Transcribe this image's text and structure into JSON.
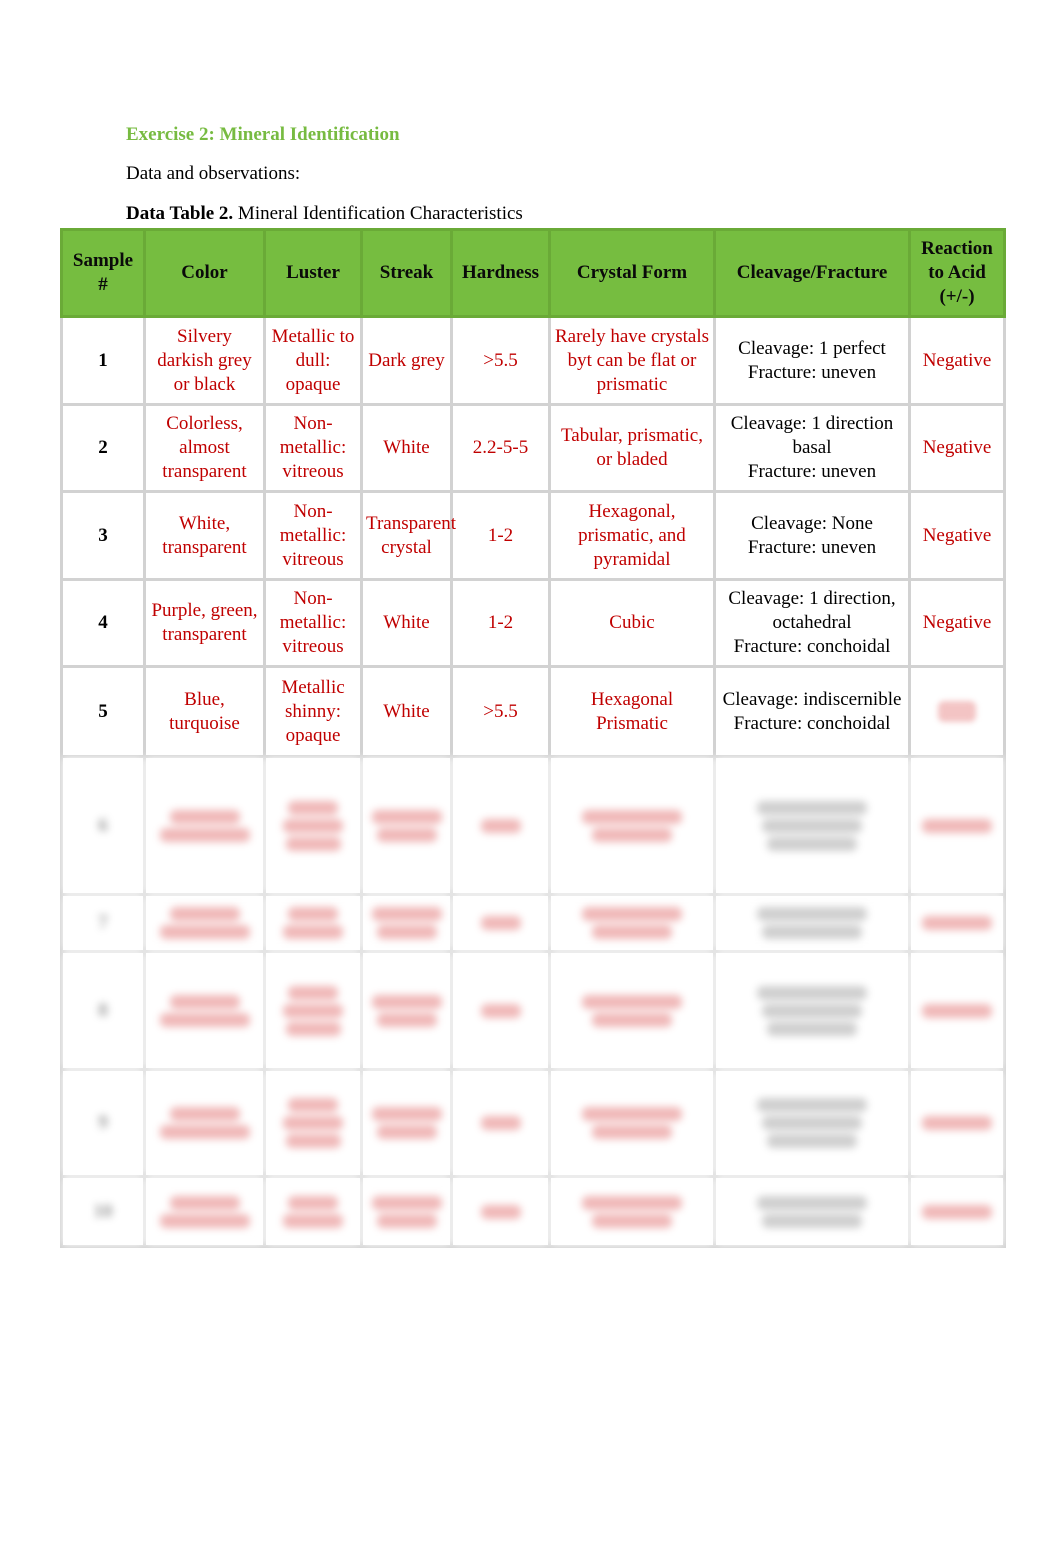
{
  "heading": "Exercise 2: Mineral Identification",
  "subtext": "Data and observations:",
  "caption": {
    "bold": "Data Table 2.",
    "rest": " Mineral Identification Characteristics"
  },
  "colors": {
    "heading": "#77bb41",
    "header_bg": "#76bd40",
    "answer_text": "#c00000"
  },
  "table": {
    "headers": [
      "Sample #",
      "Color",
      "Luster",
      "Streak",
      "Hardness",
      "Crystal Form",
      "Cleavage/Fracture",
      "Reaction to Acid (+/-)"
    ],
    "rows": [
      {
        "sample": "1",
        "color": "Silvery darkish grey or black",
        "luster": "Metallic to dull: opaque",
        "streak": "Dark grey",
        "hardness": ">5.5",
        "crystal_form": "Rarely have crystals byt can be flat or prismatic",
        "cleavage_fracture": [
          "Cleavage: 1 perfect",
          "Fracture: uneven"
        ],
        "acid": "Negative"
      },
      {
        "sample": "2",
        "color": "Colorless, almost transparent",
        "luster": "Non-metallic: vitreous",
        "streak": "White",
        "hardness": "2.2-5-5",
        "crystal_form": "Tabular, prismatic, or bladed",
        "cleavage_fracture": [
          "Cleavage: 1 direction basal",
          "Fracture: uneven"
        ],
        "acid": "Negative"
      },
      {
        "sample": "3",
        "color": "White, transparent",
        "luster": "Non-metallic: vitreous",
        "streak": "Transparent crystal",
        "hardness": "1-2",
        "crystal_form": "Hexagonal, prismatic, and pyramidal",
        "cleavage_fracture": [
          "Cleavage: None",
          "Fracture: uneven"
        ],
        "acid": "Negative"
      },
      {
        "sample": "4",
        "color": "Purple, green, transparent",
        "luster": "Non-metallic: vitreous",
        "streak": "White",
        "hardness": "1-2",
        "crystal_form": "Cubic",
        "cleavage_fracture": [
          "Cleavage: 1 direction, octahedral",
          "Fracture: conchoidal"
        ],
        "acid": "Negative"
      },
      {
        "sample": "5",
        "color": "Blue, turquoise",
        "luster": "Metallic shinny: opaque",
        "streak": "White",
        "hardness": ">5.5",
        "crystal_form": "Hexagonal Prismatic",
        "cleavage_fracture": [
          "Cleavage: indiscernible",
          "Fracture: conchoidal"
        ],
        "acid": ""
      }
    ],
    "obscured_rows": [
      {
        "sample": "6"
      },
      {
        "sample": "7"
      },
      {
        "sample": "8"
      },
      {
        "sample": "9"
      },
      {
        "sample": "10"
      }
    ]
  }
}
